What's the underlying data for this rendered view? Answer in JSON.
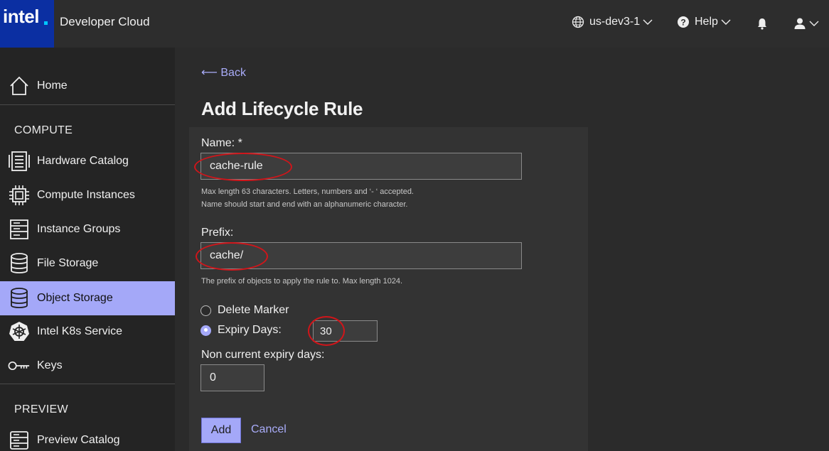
{
  "header": {
    "logo_text": "intel",
    "brand": "Developer Cloud",
    "region": "us-dev3-1",
    "help": "Help",
    "icons": [
      "globe-icon",
      "help-circle-icon",
      "bell-icon",
      "user-icon"
    ]
  },
  "sidebar": {
    "home": "Home",
    "compute_title": "COMPUTE",
    "items": [
      {
        "label": "Hardware Catalog",
        "icon": "server-rack-icon"
      },
      {
        "label": "Compute Instances",
        "icon": "cpu-chip-icon"
      },
      {
        "label": "Instance Groups",
        "icon": "instance-groups-icon"
      },
      {
        "label": "File Storage",
        "icon": "database-icon"
      },
      {
        "label": "Object Storage",
        "icon": "database-icon",
        "active": true
      },
      {
        "label": "Intel K8s Service",
        "icon": "kubernetes-icon"
      },
      {
        "label": "Keys",
        "icon": "key-icon"
      }
    ],
    "preview_title": "PREVIEW",
    "preview_items": [
      {
        "label": "Preview Catalog",
        "icon": "catalog-icon"
      }
    ]
  },
  "main": {
    "back": "⟵ Back",
    "title": "Add Lifecycle Rule",
    "name_label": "Name: *",
    "name_value": "cache-rule",
    "name_hint_1": "Max length 63 characters. Letters, numbers and ‘- ‘ accepted.",
    "name_hint_2": "Name should start and end with an alphanumeric character.",
    "prefix_label": "Prefix:",
    "prefix_value": "cache/",
    "prefix_hint": "The prefix of objects to apply the rule to. Max length 1024.",
    "radio_delete": "Delete Marker",
    "radio_expiry": "Expiry Days:",
    "selected_option": "Expiry Days:",
    "expiry_value": "30",
    "noncurrent_label": "Non current expiry days:",
    "noncurrent_value": "0",
    "add_button": "Add",
    "cancel_button": "Cancel"
  },
  "colors": {
    "accent": "#a4a8f8",
    "logo_bg": "#0b2fa2",
    "annotation": "#d0151a"
  }
}
